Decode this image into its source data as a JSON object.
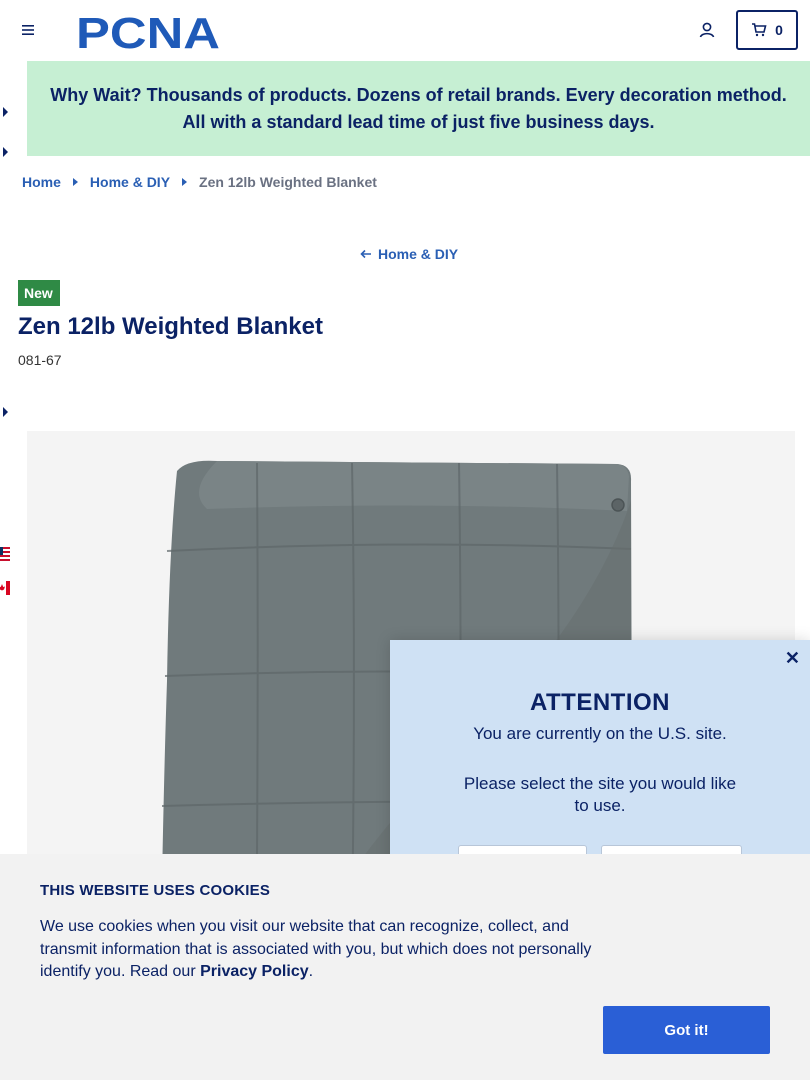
{
  "header": {
    "logo_text": "PCNA",
    "cart_count": "0",
    "icons": {
      "menu": "hamburger-icon",
      "account": "user-icon",
      "cart": "cart-icon"
    }
  },
  "promo": {
    "text": "Why Wait? Thousands of products. Dozens of retail brands. Every decoration method. All with a standard lead time of just five business days."
  },
  "breadcrumb": {
    "items": [
      "Home",
      "Home & DIY"
    ],
    "current": "Zen 12lb Weighted Blanket"
  },
  "back_link": "Home & DIY",
  "product": {
    "badge": "New",
    "title": "Zen 12lb Weighted Blanket",
    "sku": "081-67",
    "image_color": "#707a7c"
  },
  "attention": {
    "title": "ATTENTION",
    "line1": "You are currently on the U.S. site.",
    "line2": "Please select the site you would like to use."
  },
  "cookie": {
    "title": "THIS WEBSITE USES COOKIES",
    "body": "We use cookies when you visit our website that can recognize, collect, and transmit information that is associated with you, but which does not personally identify you. Read our ",
    "link": "Privacy Policy",
    "end": ".",
    "button": "Got it!"
  },
  "colors": {
    "brand_navy": "#0b2265",
    "link_blue": "#2a5fb4",
    "promo_green": "#c6efd3",
    "badge_green": "#2f8a45",
    "modal_blue": "#cfe1f4",
    "cta_blue": "#2a5fd6"
  }
}
